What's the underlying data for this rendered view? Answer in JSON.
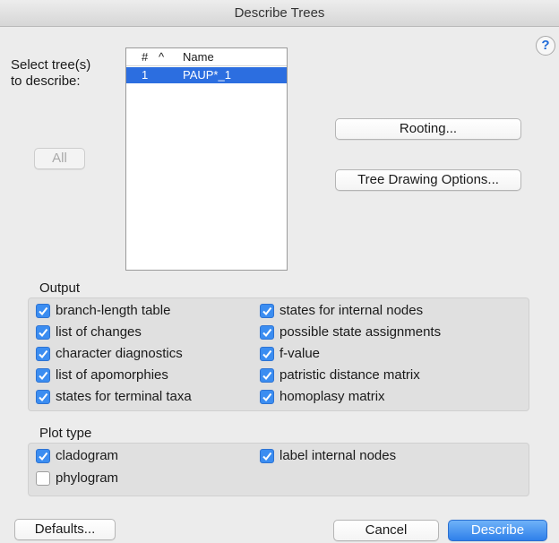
{
  "window": {
    "title": "Describe Trees"
  },
  "help": {
    "label": "?"
  },
  "select_label": {
    "line1": "Select tree(s)",
    "line2": "to describe:"
  },
  "all_button": "All",
  "tree_list": {
    "columns": [
      "#",
      "^",
      "Name"
    ],
    "rows": [
      {
        "num": "1",
        "name": "PAUP*_1",
        "selected": true
      }
    ]
  },
  "buttons": {
    "rooting": "Rooting...",
    "tree_drawing": "Tree Drawing Options...",
    "defaults": "Defaults...",
    "cancel": "Cancel",
    "describe": "Describe"
  },
  "output": {
    "title": "Output",
    "left": [
      {
        "label": "branch-length table",
        "checked": true
      },
      {
        "label": "list of changes",
        "checked": true
      },
      {
        "label": "character diagnostics",
        "checked": true
      },
      {
        "label": "list of apomorphies",
        "checked": true
      },
      {
        "label": "states for terminal taxa",
        "checked": true
      }
    ],
    "right": [
      {
        "label": "states for internal nodes",
        "checked": true
      },
      {
        "label": "possible state assignments",
        "checked": true
      },
      {
        "label": "f-value",
        "checked": true
      },
      {
        "label": "patristic distance matrix",
        "checked": true
      },
      {
        "label": "homoplasy matrix",
        "checked": true
      }
    ]
  },
  "plot_type": {
    "title": "Plot type",
    "left": [
      {
        "label": "cladogram",
        "checked": true
      },
      {
        "label": "phylogram",
        "checked": false
      }
    ],
    "right": [
      {
        "label": "label internal nodes",
        "checked": true
      }
    ]
  },
  "colors": {
    "accent": "#3b8df1",
    "selection": "#2c6ee0",
    "panel": "#e0e0e0"
  },
  "icons": {
    "check": "checkmark-icon",
    "help": "help-icon",
    "sort": "sort-ascending-icon"
  }
}
